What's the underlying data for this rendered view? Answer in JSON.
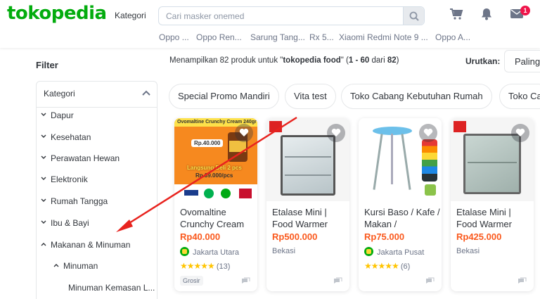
{
  "header": {
    "logo": "tokopedia",
    "kategori": "Kategori",
    "search_placeholder": "Cari masker onemed",
    "cart_badge": "1",
    "keywords": [
      "Oppo ...",
      "Oppo Ren...",
      "Sarung Tang...",
      "Rx 5...",
      "Xiaomi Redmi Note 9 ...",
      "Oppo A..."
    ]
  },
  "sidebar": {
    "title": "Filter",
    "section": "Kategori",
    "items": [
      {
        "label": "Dapur"
      },
      {
        "label": "Kesehatan"
      },
      {
        "label": "Perawatan Hewan"
      },
      {
        "label": "Elektronik"
      },
      {
        "label": "Rumah Tangga"
      },
      {
        "label": "Ibu & Bayi"
      },
      {
        "label": "Makanan & Minuman"
      },
      {
        "label": "Minuman"
      },
      {
        "label": "Minuman Kemasan L..."
      }
    ]
  },
  "results": {
    "prefix": "Menampilkan 82 produk untuk \"",
    "query": "tokopedia food",
    "mid": "\" (",
    "range": "1 - 60",
    "from": " dari ",
    "total": "82",
    "suffix": ")"
  },
  "sort": {
    "label": "Urutkan:",
    "value": "Paling"
  },
  "chips": [
    "Special Promo Mandiri",
    "Vita test",
    "Toko Cabang Kebutuhan Rumah",
    "Toko Ca"
  ],
  "products": [
    {
      "name": "Ovomaltine Crunchy Cream",
      "price": "Rp40.000",
      "location": "Jakarta Utara",
      "official": true,
      "rating_count": "(13)",
      "grosir": "Grosir",
      "banner_top": "Ovomaltine Crunchy Cream 240gr",
      "banner_price": "Rp.40.000",
      "banner_promo": "Langsung Beli 2 pcs",
      "banner_promo_price": "Rp.39.000/pcs"
    },
    {
      "name": "Etalase Mini | Food Warmer",
      "price": "Rp500.000",
      "location": "Bekasi",
      "official": false
    },
    {
      "name": "Kursi Baso / Kafe / Makan /",
      "price": "Rp75.000",
      "location": "Jakarta Pusat",
      "official": true,
      "rating_count": "(6)"
    },
    {
      "name": "Etalase Mini | Food Warmer",
      "price": "Rp425.000",
      "location": "Bekasi",
      "official": false
    }
  ],
  "colors": {
    "brand": "#03ac0e",
    "price": "#fa591d",
    "badge": "#ef144a",
    "arrow": "#e8231e"
  }
}
